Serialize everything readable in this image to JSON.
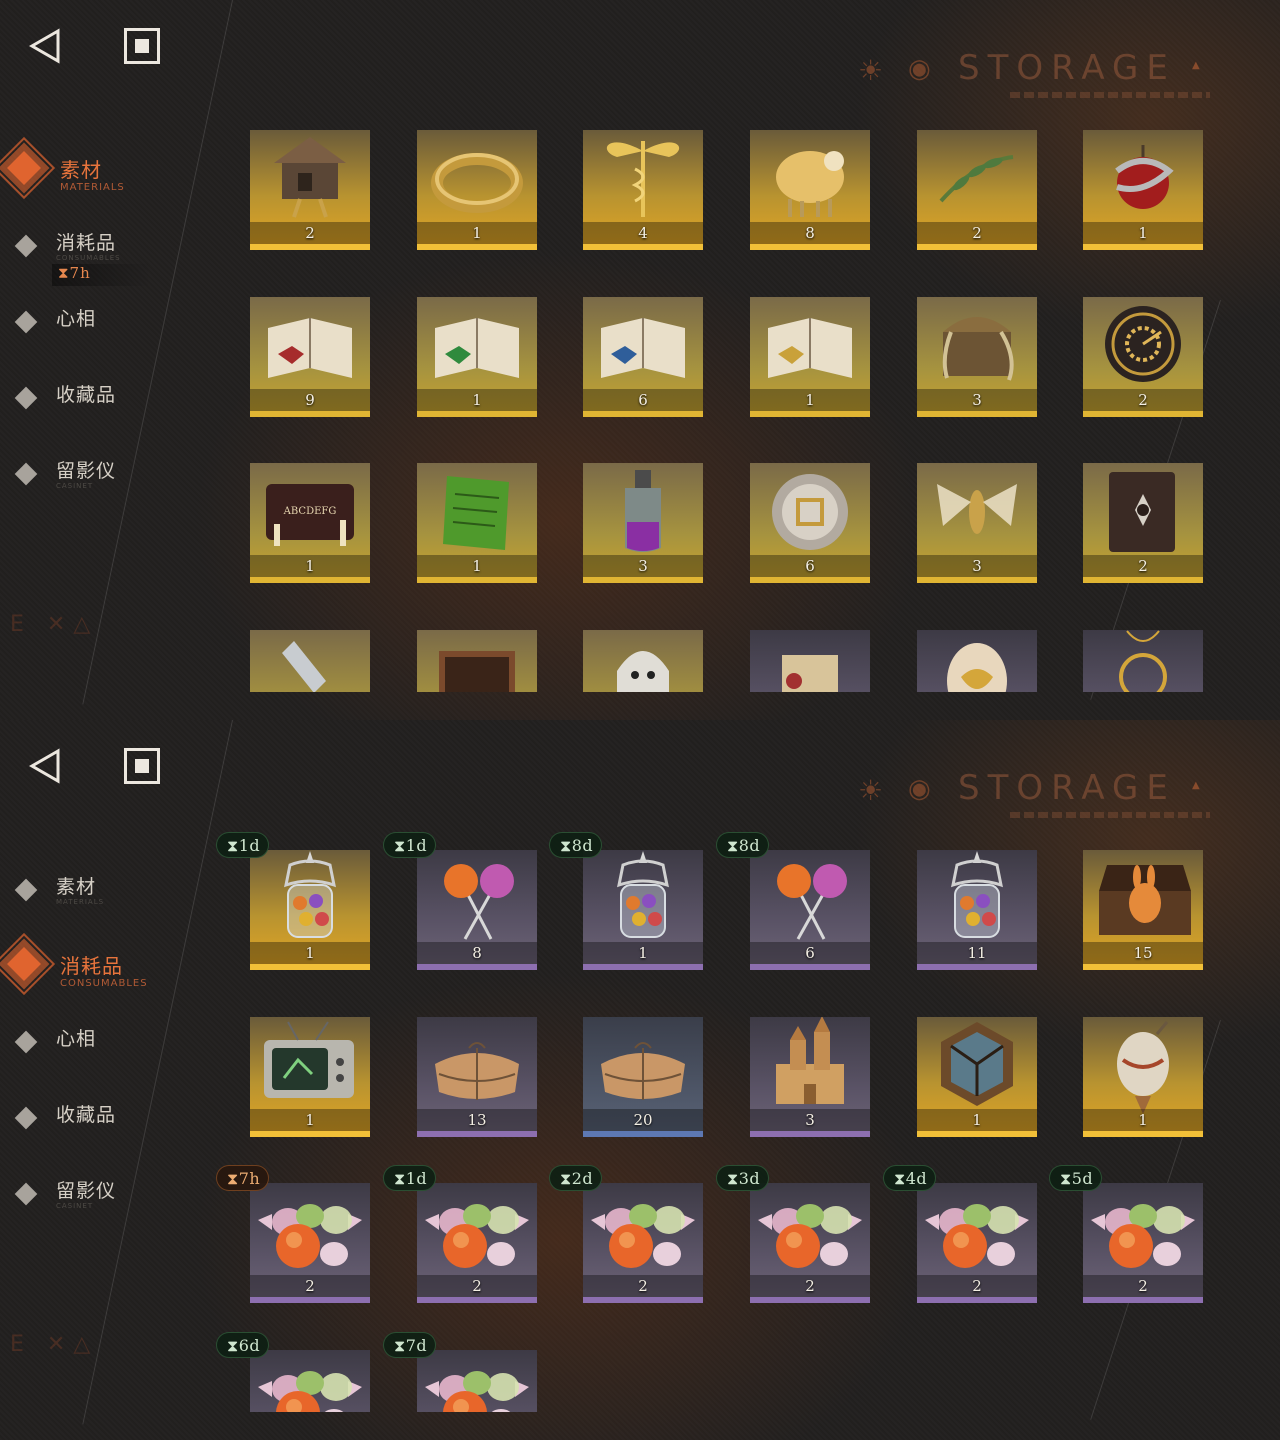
{
  "panels": [
    {
      "header": {
        "back_icon": "back-triangle-icon",
        "home_icon": "square-stop-icon",
        "storage_title": "STORAGE"
      },
      "nav": [
        {
          "label": "素材",
          "sub": "MATERIALS",
          "active": true
        },
        {
          "label": "消耗品",
          "sub": "CONSUMABLES",
          "active": false,
          "timer": "⧗7h"
        },
        {
          "label": "心相",
          "sub": "",
          "active": false
        },
        {
          "label": "收藏品",
          "sub": "",
          "active": false
        },
        {
          "label": "留影仪",
          "sub": "CASINET",
          "active": false
        }
      ],
      "corner_marks": "E ✕△",
      "items": [
        {
          "icon": "hut-on-legs-icon",
          "qty": "2",
          "rarity": "gold"
        },
        {
          "icon": "golden-ring-icon",
          "qty": "1",
          "rarity": "gold"
        },
        {
          "icon": "caduceus-icon",
          "qty": "4",
          "rarity": "gold"
        },
        {
          "icon": "golden-sheep-icon",
          "qty": "8",
          "rarity": "gold"
        },
        {
          "icon": "laurel-branch-icon",
          "qty": "2",
          "rarity": "gold"
        },
        {
          "icon": "apple-snake-icon",
          "qty": "1",
          "rarity": "gold"
        },
        {
          "icon": "red-book-icon",
          "qty": "9",
          "rarity": "gold2"
        },
        {
          "icon": "green-book-icon",
          "qty": "1",
          "rarity": "gold2"
        },
        {
          "icon": "blue-book-icon",
          "qty": "6",
          "rarity": "gold2"
        },
        {
          "icon": "gold-book-icon",
          "qty": "1",
          "rarity": "gold2"
        },
        {
          "icon": "root-chest-icon",
          "qty": "3",
          "rarity": "gold2"
        },
        {
          "icon": "clockwork-icon",
          "qty": "2",
          "rarity": "gold2"
        },
        {
          "icon": "ouija-board-icon",
          "qty": "1",
          "rarity": "gold2"
        },
        {
          "icon": "green-tablet-icon",
          "qty": "1",
          "rarity": "gold2"
        },
        {
          "icon": "potion-bottle-icon",
          "qty": "3",
          "rarity": "gold2"
        },
        {
          "icon": "metal-disc-icon",
          "qty": "6",
          "rarity": "gold2"
        },
        {
          "icon": "moth-icon",
          "qty": "3",
          "rarity": "gold2"
        },
        {
          "icon": "dark-tome-icon",
          "qty": "2",
          "rarity": "gold2"
        },
        {
          "icon": "pen-nib-icon",
          "qty": "",
          "rarity": "gold2"
        },
        {
          "icon": "wooden-case-icon",
          "qty": "",
          "rarity": "gold2"
        },
        {
          "icon": "ghost-icon",
          "qty": "",
          "rarity": "gold2"
        },
        {
          "icon": "scroll-icon",
          "qty": "",
          "rarity": "purple"
        },
        {
          "icon": "ornate-egg-icon",
          "qty": "",
          "rarity": "purple"
        },
        {
          "icon": "pendant-icon",
          "qty": "",
          "rarity": "purple"
        }
      ]
    },
    {
      "header": {
        "back_icon": "back-triangle-icon",
        "home_icon": "square-stop-icon",
        "storage_title": "STORAGE"
      },
      "nav": [
        {
          "label": "素材",
          "sub": "MATERIALS",
          "active": false
        },
        {
          "label": "消耗品",
          "sub": "CONSUMABLES",
          "active": true
        },
        {
          "label": "心相",
          "sub": "",
          "active": false
        },
        {
          "label": "收藏品",
          "sub": "",
          "active": false
        },
        {
          "label": "留影仪",
          "sub": "CASINET",
          "active": false
        }
      ],
      "corner_marks": "E ✕△",
      "items": [
        {
          "icon": "candy-jar-icon",
          "qty": "1",
          "rarity": "gold",
          "timer": "⧗1d",
          "timer_color": "green"
        },
        {
          "icon": "lollipops-icon",
          "qty": "8",
          "rarity": "purple",
          "timer": "⧗1d",
          "timer_color": "green"
        },
        {
          "icon": "candy-jar-icon",
          "qty": "1",
          "rarity": "purple",
          "timer": "⧗8d",
          "timer_color": "green"
        },
        {
          "icon": "lollipops-icon",
          "qty": "6",
          "rarity": "purple",
          "timer": "⧗8d",
          "timer_color": "green"
        },
        {
          "icon": "candy-jar-icon",
          "qty": "11",
          "rarity": "purple"
        },
        {
          "icon": "rabbit-box-icon",
          "qty": "15",
          "rarity": "gold"
        },
        {
          "icon": "retro-tv-icon",
          "qty": "1",
          "rarity": "gold"
        },
        {
          "icon": "parcel-icon",
          "qty": "13",
          "rarity": "purple"
        },
        {
          "icon": "parcel-icon",
          "qty": "20",
          "rarity": "blue"
        },
        {
          "icon": "sand-castle-icon",
          "qty": "3",
          "rarity": "purple"
        },
        {
          "icon": "stained-medal-icon",
          "qty": "1",
          "rarity": "gold"
        },
        {
          "icon": "ornament-icon",
          "qty": "1",
          "rarity": "gold"
        },
        {
          "icon": "candies-icon",
          "qty": "2",
          "rarity": "purple",
          "timer": "⧗7h",
          "timer_color": "orange"
        },
        {
          "icon": "candies-icon",
          "qty": "2",
          "rarity": "purple",
          "timer": "⧗1d",
          "timer_color": "green"
        },
        {
          "icon": "candies-icon",
          "qty": "2",
          "rarity": "purple",
          "timer": "⧗2d",
          "timer_color": "green"
        },
        {
          "icon": "candies-icon",
          "qty": "2",
          "rarity": "purple",
          "timer": "⧗3d",
          "timer_color": "green"
        },
        {
          "icon": "candies-icon",
          "qty": "2",
          "rarity": "purple",
          "timer": "⧗4d",
          "timer_color": "green"
        },
        {
          "icon": "candies-icon",
          "qty": "2",
          "rarity": "purple",
          "timer": "⧗5d",
          "timer_color": "green"
        },
        {
          "icon": "candies-icon",
          "qty": "",
          "rarity": "purple",
          "timer": "⧗6d",
          "timer_color": "green"
        },
        {
          "icon": "candies-icon",
          "qty": "",
          "rarity": "purple",
          "timer": "⧗7d",
          "timer_color": "green"
        }
      ]
    }
  ]
}
